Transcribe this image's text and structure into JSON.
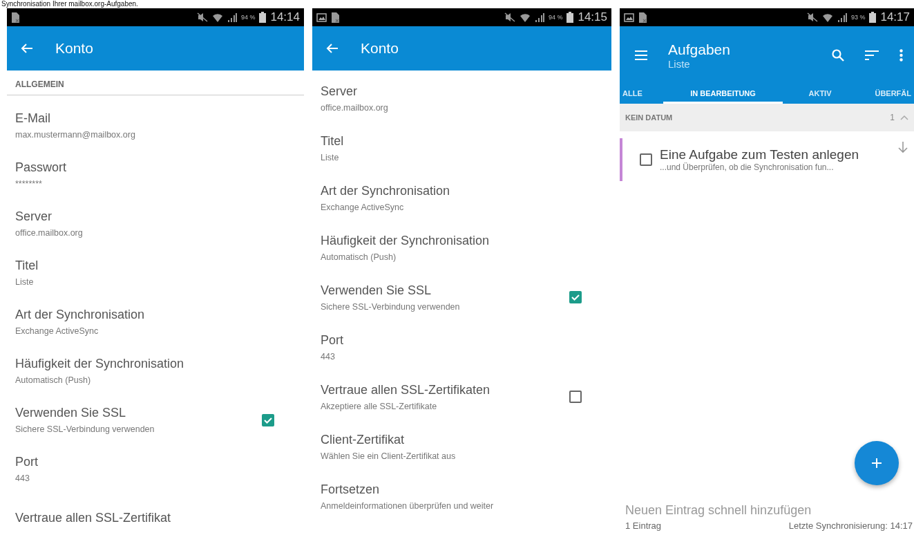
{
  "caption": "Synchronisation Ihrer mailbox.org-Aufgaben.",
  "screens": [
    {
      "kind": "settings",
      "status_bar": {
        "notifications": [
          {
            "kind": "sim"
          }
        ],
        "battery": "94 %",
        "time": "14:14"
      },
      "app_bar": {
        "title": "Konto"
      },
      "section_header": "ALLGEMEIN",
      "items": [
        {
          "kind": "text",
          "title": "E-Mail",
          "summary": "max.mustermann@mailbox.org"
        },
        {
          "kind": "text",
          "title": "Passwort",
          "summary": "********"
        },
        {
          "kind": "text",
          "title": "Server",
          "summary": "office.mailbox.org"
        },
        {
          "kind": "text",
          "title": "Titel",
          "summary": "Liste"
        },
        {
          "kind": "text",
          "title": "Art der Synchronisation",
          "summary": "Exchange ActiveSync"
        },
        {
          "kind": "text",
          "title": "Häufigkeit der Synchronisation",
          "summary": "Automatisch (Push)"
        },
        {
          "kind": "checkbox",
          "title": "Verwenden Sie SSL",
          "summary": "Sichere SSL-Verbindung verwenden",
          "checked": true
        },
        {
          "kind": "text",
          "title": "Port",
          "summary": "443"
        },
        {
          "kind": "text",
          "title": "Vertraue allen SSL-Zertifikat"
        }
      ]
    },
    {
      "kind": "settings",
      "status_bar": {
        "notifications": [
          {
            "kind": "picture"
          },
          {
            "kind": "sim"
          }
        ],
        "battery": "94 %",
        "time": "14:15"
      },
      "app_bar": {
        "title": "Konto"
      },
      "items": [
        {
          "kind": "text",
          "title": "Server",
          "summary": "office.mailbox.org"
        },
        {
          "kind": "text",
          "title": "Titel",
          "summary": "Liste"
        },
        {
          "kind": "text",
          "title": "Art der Synchronisation",
          "summary": "Exchange ActiveSync"
        },
        {
          "kind": "text",
          "title": "Häufigkeit der Synchronisation",
          "summary": "Automatisch (Push)"
        },
        {
          "kind": "checkbox",
          "title": "Verwenden Sie SSL",
          "summary": "Sichere SSL-Verbindung verwenden",
          "checked": true
        },
        {
          "kind": "text",
          "title": "Port",
          "summary": "443"
        },
        {
          "kind": "checkbox",
          "title": "Vertraue allen SSL-Zertifikaten",
          "summary": "Akzeptiere alle SSL-Zertifikate",
          "checked": false
        },
        {
          "kind": "text",
          "title": "Client-Zertifikat",
          "summary": "Wählen Sie ein Client-Zertifikat aus"
        },
        {
          "kind": "text",
          "title": "Fortsetzen",
          "summary": "Anmeldeinformationen überprüfen und weiter"
        }
      ]
    },
    {
      "kind": "tasks",
      "status_bar": {
        "notifications": [
          {
            "kind": "picture"
          },
          {
            "kind": "sim"
          }
        ],
        "battery": "93 %",
        "time": "14:17"
      },
      "app_bar": {
        "title": "Aufgaben",
        "subtitle": "Liste"
      },
      "tabs": [
        {
          "label": "ALLE",
          "selected": false
        },
        {
          "label": "IN BEARBEITUNG",
          "selected": true
        },
        {
          "label": "AKTIV",
          "selected": false
        },
        {
          "label": "ÜBERFÄL",
          "selected": false
        }
      ],
      "groups": [
        {
          "header": "KEIN DATUM",
          "count": "1",
          "expanded": true,
          "tasks": [
            {
              "title": "Eine Aufgabe zum Testen anlegen",
              "subtitle": "...und Überprüfen, ob die Synchronisation fun...",
              "color": "#c586d6",
              "checked": false
            }
          ]
        }
      ],
      "quick_add": {
        "placeholder": "Neuen Eintrag schnell hinzufügen"
      },
      "footer": {
        "count": "1 Eintrag",
        "last_sync": "Letzte Synchronisierung: 14:17"
      }
    }
  ]
}
